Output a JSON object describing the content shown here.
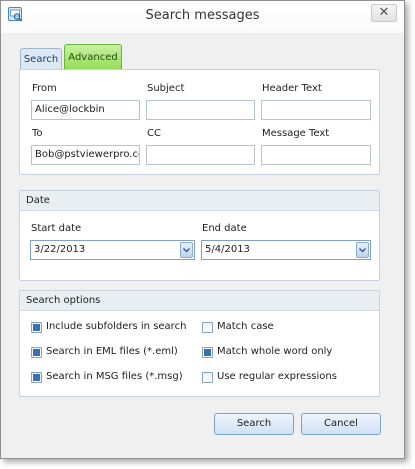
{
  "window": {
    "title": "Search messages"
  },
  "titlebar": {
    "app_icon": "search-messages-icon",
    "close_icon": "close-icon",
    "close_glyph": "✕"
  },
  "tabs": [
    {
      "label": "Search",
      "active": false
    },
    {
      "label": "Advanced",
      "active": true
    }
  ],
  "fields": {
    "from": {
      "label": "From",
      "value": "Alice@lockbin"
    },
    "subject": {
      "label": "Subject",
      "value": ""
    },
    "header_text": {
      "label": "Header Text",
      "value": ""
    },
    "to": {
      "label": "To",
      "value": "Bob@pstviewerpro.com"
    },
    "cc": {
      "label": "CC",
      "value": ""
    },
    "message_text": {
      "label": "Message Text",
      "value": ""
    }
  },
  "date": {
    "title": "Date",
    "start_label": "Start date",
    "start_value": "3/22/2013",
    "end_label": "End date",
    "end_value": "5/4/2013"
  },
  "options": {
    "title": "Search options",
    "items": [
      {
        "label": "Include subfolders in search",
        "checked": true
      },
      {
        "label": "Search in EML files (*.eml)",
        "checked": true
      },
      {
        "label": "Search in MSG files (*.msg)",
        "checked": true
      },
      {
        "label": "Match case",
        "checked": false
      },
      {
        "label": "Match whole word only",
        "checked": true
      },
      {
        "label": "Use regular expressions",
        "checked": false
      }
    ]
  },
  "buttons": {
    "search": "Search",
    "cancel": "Cancel"
  },
  "colors": {
    "accent_green": "#8fdc52",
    "accent_blue": "#7aa3ce",
    "check_blue": "#3a6fb2"
  }
}
